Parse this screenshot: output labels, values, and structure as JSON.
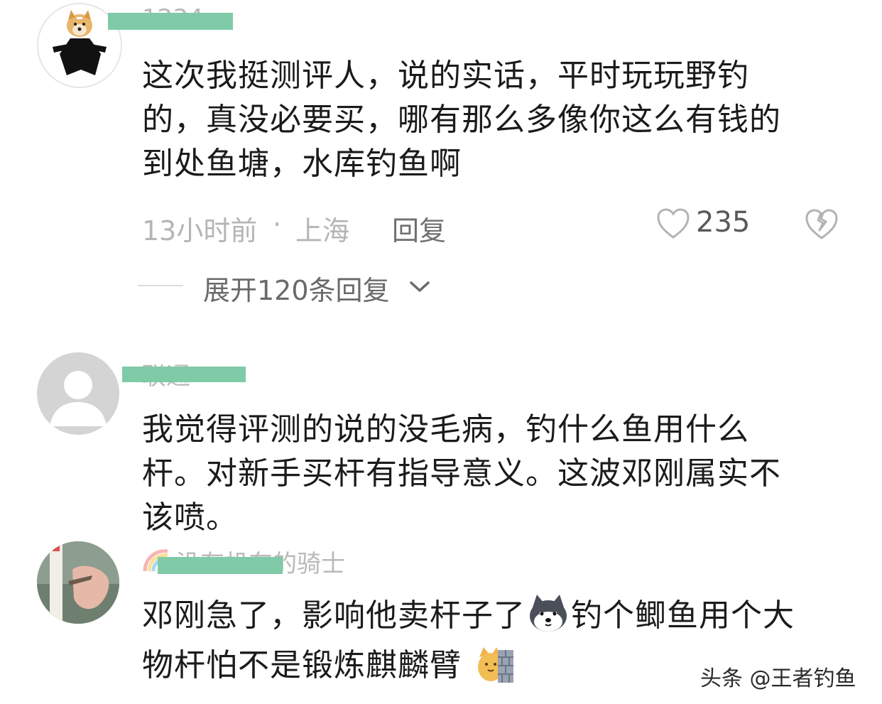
{
  "comments": [
    {
      "username": "1234",
      "text_lines": [
        "这次我挺测评人，说的实话，平时玩玩野钓",
        "的，真没必要买，哪有那么多像你这么有钱的",
        "到处鱼塘，水库钓鱼啊"
      ],
      "time": "13小时前",
      "separator": "·",
      "location": "上海",
      "reply_label": "回复",
      "likes": "235",
      "expand_label": "展开120条回复"
    },
    {
      "username": "联通",
      "text_lines": [
        "我觉得评测的说的没毛病，钓什么鱼用什么",
        "杆。对新手买杆有指导意义。这波邓刚属实不",
        "该喷。"
      ]
    },
    {
      "username": "没有机车的骑士",
      "line1_a": "邓刚急了，影响他卖杆子了",
      "line1_b": "钓个鲫鱼用个大",
      "line2": "物杆怕不是锻炼麒麟臂"
    }
  ],
  "watermark": "头条 @王者钓鱼",
  "icons": {
    "heart": "heart-outline-icon",
    "dislike": "broken-heart-icon",
    "chevron": "chevron-down-icon",
    "emoji_husky": "husky-emoji-icon",
    "emoji_cat_wall": "cat-behind-wall-emoji-icon"
  },
  "colors": {
    "mask": "#7fcaa7",
    "meta_text": "#b5b5b5",
    "body_text": "#1b1b1b"
  }
}
